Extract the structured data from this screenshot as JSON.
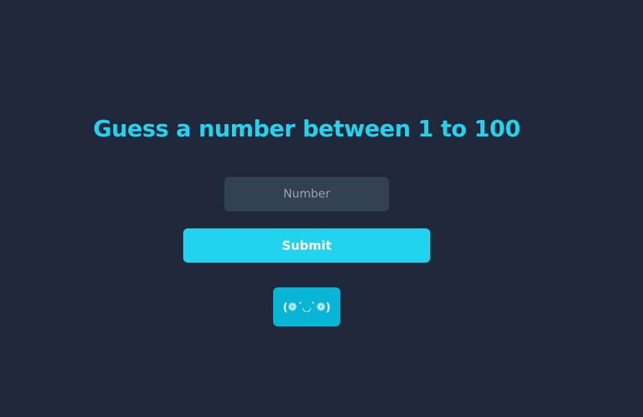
{
  "game": {
    "title": "Guess a number between 1 to 100",
    "input_placeholder": "Number",
    "input_value": "",
    "submit_label": "Submit",
    "feedback_emoticon": "(❁´◡`❁)"
  },
  "colors": {
    "background": "#1f293b",
    "accent": "#22d3ee",
    "input_bg": "#334155",
    "badge_bg": "#06b6d4"
  }
}
